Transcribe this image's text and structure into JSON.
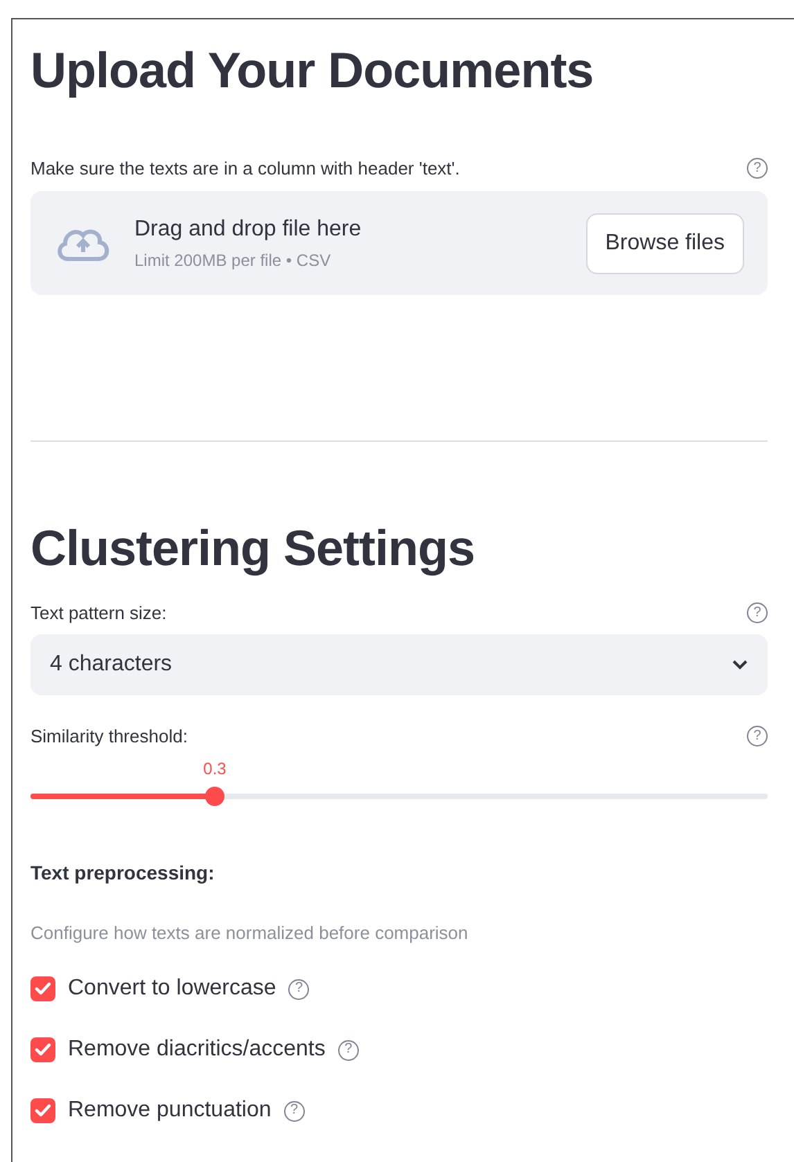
{
  "upload_section": {
    "heading": "Upload Your Documents",
    "uploader": {
      "label": "Make sure the texts are in a column with header 'text'.",
      "help": "?",
      "instruction": "Drag and drop file here",
      "limit": "Limit 200MB per file • CSV",
      "button": "Browse files"
    }
  },
  "settings_section": {
    "heading": "Clustering Settings",
    "pattern_size": {
      "label": "Text pattern size:",
      "help": "?",
      "value": "4 characters"
    },
    "similarity": {
      "label": "Similarity threshold:",
      "help": "?",
      "reading": "0.3",
      "level": 0.25
    },
    "preprocessing": {
      "heading": "Text preprocessing:",
      "caption": "Configure how texts are normalized before comparison",
      "options": [
        {
          "label": "Convert to lowercase",
          "checked": true,
          "help": "?"
        },
        {
          "label": "Remove diacritics/accents",
          "checked": true,
          "help": "?"
        },
        {
          "label": "Remove punctuation",
          "checked": true,
          "help": "?"
        }
      ]
    }
  }
}
